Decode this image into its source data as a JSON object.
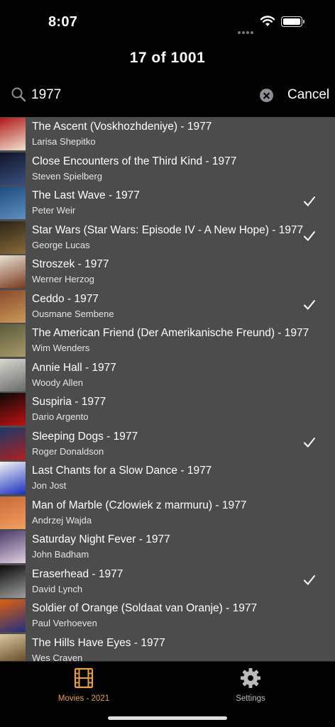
{
  "status": {
    "time": "8:07"
  },
  "nav": {
    "title": "17 of 1001"
  },
  "search": {
    "query": "1977",
    "cancel_label": "Cancel"
  },
  "colors": {
    "accent": "#e8a33a",
    "list_bg": "#4c4c4c"
  },
  "movies": [
    {
      "title": "The Ascent (Voskhozhdeniye) - 1977",
      "director": "Larisa Shepitko",
      "checked": false,
      "poster": [
        "#b01818",
        "#f0e2d0"
      ]
    },
    {
      "title": "Close Encounters of the Third Kind - 1977",
      "director": "Steven Spielberg",
      "checked": false,
      "poster": [
        "#101428",
        "#3a4f80"
      ]
    },
    {
      "title": "The Last Wave - 1977",
      "director": "Peter Weir",
      "checked": true,
      "poster": [
        "#1d4c80",
        "#5e8ec0"
      ]
    },
    {
      "title": "Star Wars (Star Wars: Episode IV - A New Hope) - 1977",
      "director": "George Lucas",
      "checked": true,
      "poster": [
        "#2c2418",
        "#8a6a3a"
      ]
    },
    {
      "title": "Stroszek - 1977",
      "director": "Werner Herzog",
      "checked": false,
      "poster": [
        "#e8e2d2",
        "#7a3a20"
      ]
    },
    {
      "title": "Ceddo - 1977",
      "director": "Ousmane Sembene",
      "checked": true,
      "poster": [
        "#8a4a2a",
        "#c89a5a"
      ]
    },
    {
      "title": "The American Friend (Der Amerikanische Freund) - 1977",
      "director": "Wim Wenders",
      "checked": false,
      "poster": [
        "#5a5a3a",
        "#a89a6a"
      ]
    },
    {
      "title": "Annie Hall - 1977",
      "director": "Woody Allen",
      "checked": false,
      "poster": [
        "#d8d8d0",
        "#6a6a6a"
      ]
    },
    {
      "title": "Suspiria - 1977",
      "director": "Dario Argento",
      "checked": false,
      "poster": [
        "#0a0a0a",
        "#c01010"
      ]
    },
    {
      "title": "Sleeping Dogs - 1977",
      "director": "Roger Donaldson",
      "checked": true,
      "poster": [
        "#1a3a6a",
        "#b02020"
      ]
    },
    {
      "title": "Last Chants for a Slow Dance - 1977",
      "director": "Jon Jost",
      "checked": false,
      "poster": [
        "#f4f4f4",
        "#1830c0"
      ]
    },
    {
      "title": "Man of Marble (Czlowiek z marmuru) - 1977",
      "director": "Andrzej Wajda",
      "checked": false,
      "poster": [
        "#c86a3a",
        "#f0a060"
      ]
    },
    {
      "title": "Saturday Night Fever - 1977",
      "director": "John Badham",
      "checked": false,
      "poster": [
        "#4a3a6a",
        "#e0d0e0"
      ]
    },
    {
      "title": "Eraserhead - 1977",
      "director": "David Lynch",
      "checked": true,
      "poster": [
        "#0a0a0a",
        "#a0a0a0"
      ]
    },
    {
      "title": "Soldier of Orange (Soldaat van Oranje) - 1977",
      "director": "Paul Verhoeven",
      "checked": false,
      "poster": [
        "#e06010",
        "#203080"
      ]
    },
    {
      "title": "The Hills Have Eyes - 1977",
      "director": "Wes Craven",
      "checked": false,
      "poster": [
        "#d8c8a0",
        "#5a3a1a"
      ]
    }
  ],
  "tabs": [
    {
      "label": "Movies - 2021",
      "icon": "film-icon",
      "selected": true
    },
    {
      "label": "Settings",
      "icon": "gear-icon",
      "selected": false
    }
  ]
}
